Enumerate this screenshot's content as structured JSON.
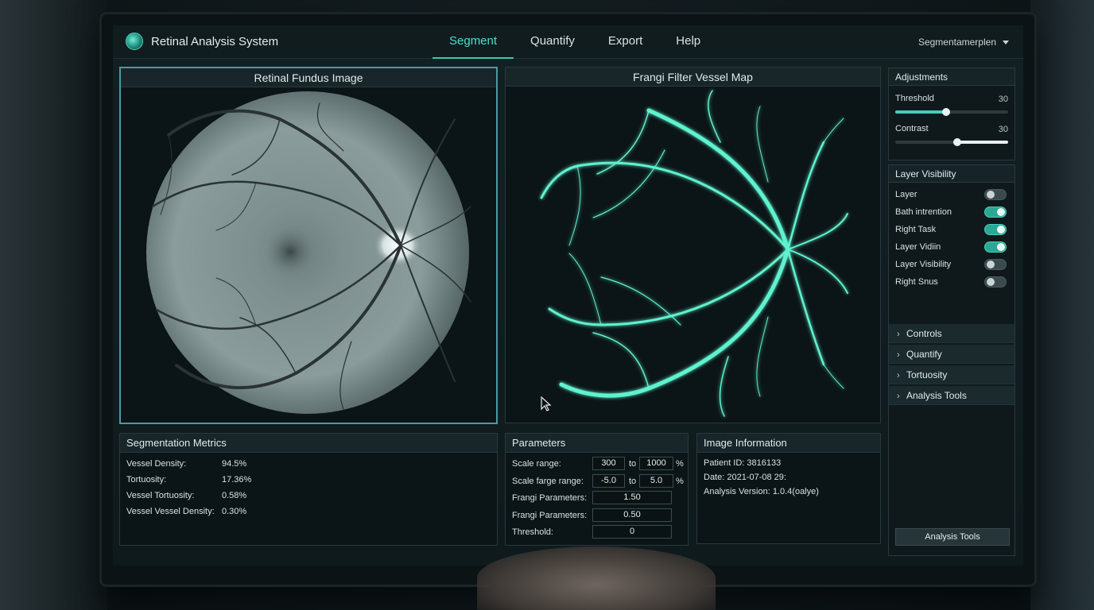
{
  "app": {
    "title": "Retinal Analysis System"
  },
  "nav": {
    "tabs": [
      {
        "label": "Segment",
        "active": true
      },
      {
        "label": "Quantify",
        "active": false
      },
      {
        "label": "Export",
        "active": false
      },
      {
        "label": "Help",
        "active": false
      }
    ],
    "profile_select": "Segmentamerplen"
  },
  "panels": {
    "fundus_title": "Retinal Fundus Image",
    "frangi_title": "Frangi Filter Vessel Map"
  },
  "adjustments": {
    "title": "Adjustments",
    "threshold": {
      "label": "Threshold",
      "value": "30",
      "level": 0.45
    },
    "contrast": {
      "label": "Contrast",
      "value": "30",
      "level": 0.55
    }
  },
  "layer_visibility": {
    "title": "Layer Visibility",
    "items": [
      {
        "label": "Layer",
        "on": false
      },
      {
        "label": "Bath intrention",
        "on": true
      },
      {
        "label": "Right Task",
        "on": true
      },
      {
        "label": "Layer Vidiin",
        "on": true
      },
      {
        "label": "Layer Visibility",
        "on": false
      },
      {
        "label": "Right Snus",
        "on": false
      }
    ]
  },
  "accordion": {
    "items": [
      "Controls",
      "Quantify",
      "Tortuosity",
      "Analysis Tools"
    ],
    "button": "Analysis Tools"
  },
  "metrics": {
    "title": "Segmentation Metrics",
    "rows": [
      {
        "label": "Vessel Density:",
        "value": "94.5%"
      },
      {
        "label": "Tortuosity:",
        "value": "17.36%"
      },
      {
        "label": "Vessel Tortuosity:",
        "value": "0.58%"
      },
      {
        "label": "Vessel Vessel Density:",
        "value": "0.30%"
      }
    ]
  },
  "parameters": {
    "title": "Parameters",
    "scale_range": {
      "label": "Scale range:",
      "from": "300",
      "to_word": "to",
      "to": "1000",
      "unit": "%"
    },
    "scale_farge_range": {
      "label": "Scale farge range:",
      "from": "-5.0",
      "to_word": "to",
      "to": "5.0",
      "unit": "%"
    },
    "frangi1": {
      "label": "Frangi Parameters:",
      "value": "1.50"
    },
    "frangi2": {
      "label": "Frangi Parameters:",
      "value": "0.50"
    },
    "threshold": {
      "label": "Threshold:",
      "value": "0"
    }
  },
  "image_info": {
    "title": "Image Information",
    "patient": "Patient ID: 3816133",
    "date": "Date: 2021-07-08 29:",
    "version": "Analysis Version: 1.0.4(oalye)"
  },
  "colors": {
    "accent": "#46cdb8",
    "vessel_glow": "#5ff2cf",
    "panel_bg": "#0b1416"
  },
  "icons": {
    "logo": "globe-logo-icon",
    "chevron": "chevron-right-icon",
    "dropdown": "caret-down-icon",
    "cursor": "mouse-pointer-icon"
  }
}
